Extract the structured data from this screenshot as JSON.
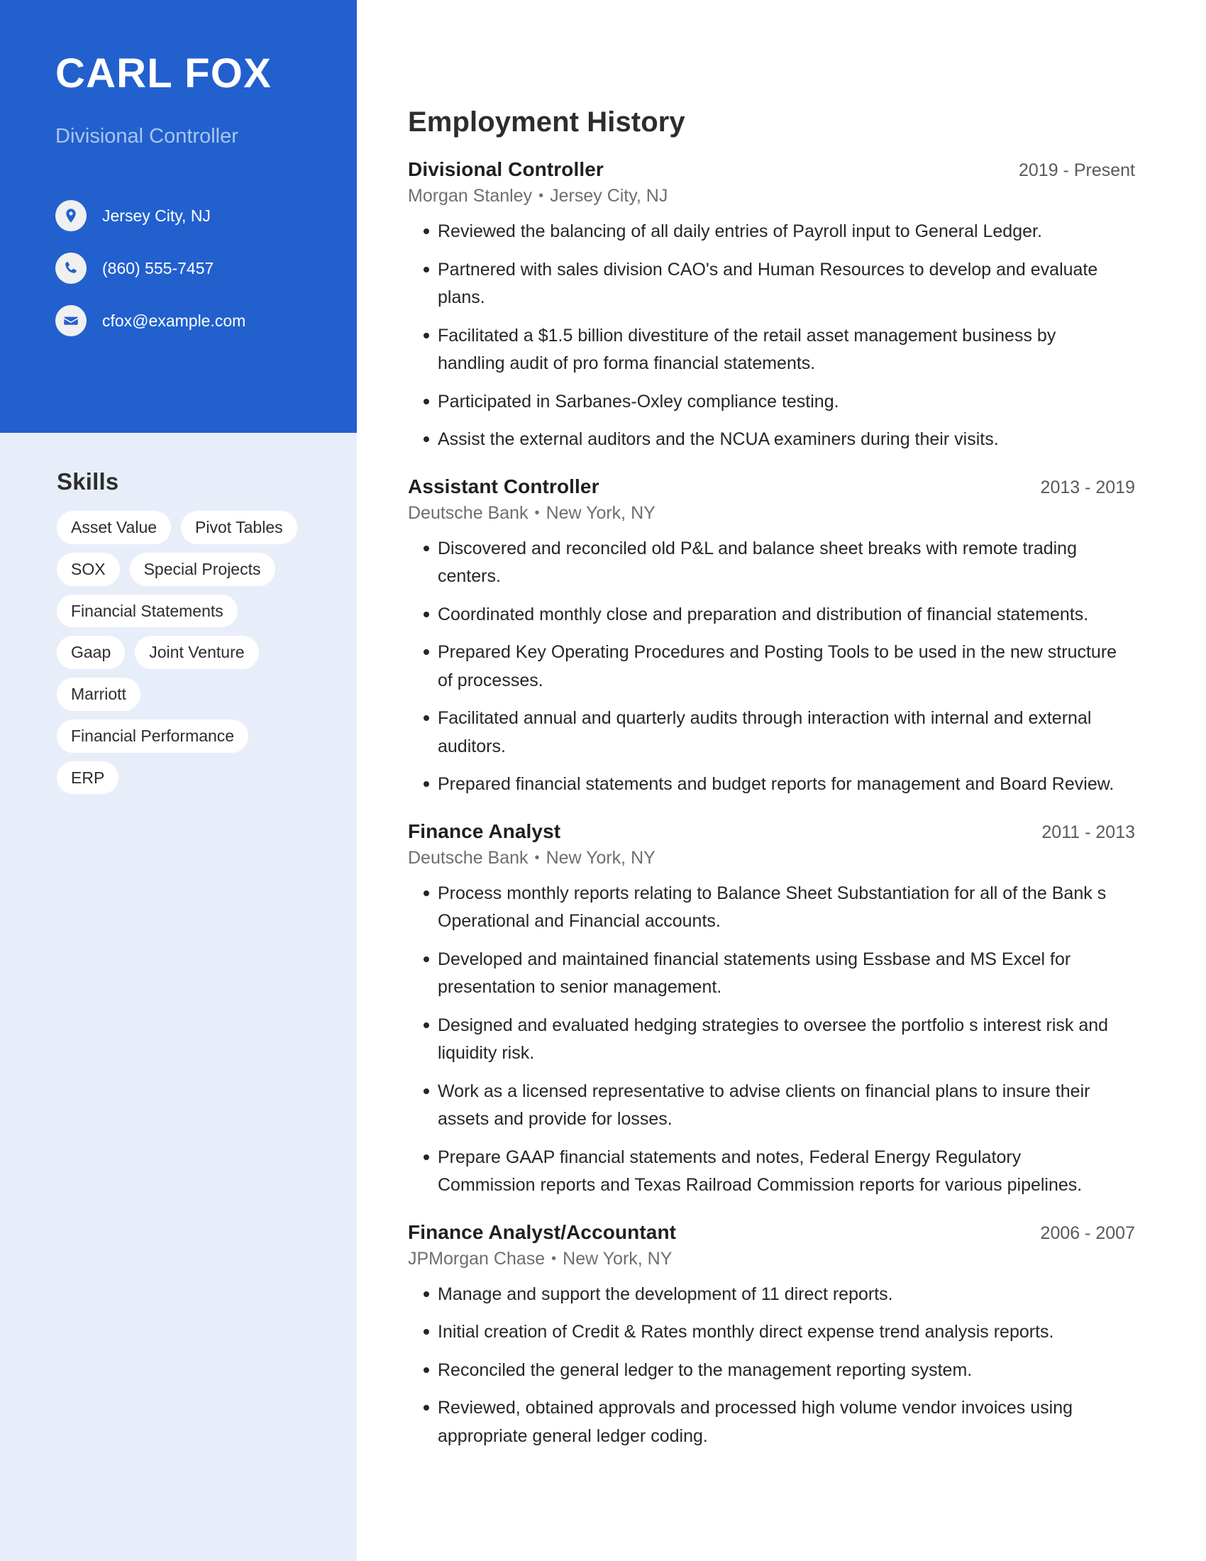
{
  "profile": {
    "name": "CARL FOX",
    "headline": "Divisional Controller"
  },
  "contact": {
    "location": "Jersey City, NJ",
    "phone": "(860) 555-7457",
    "email": "cfox@example.com",
    "location_icon": "map-pin-icon",
    "phone_icon": "phone-icon",
    "email_icon": "envelope-icon"
  },
  "skills": {
    "title": "Skills",
    "items": [
      "Asset Value",
      "Pivot Tables",
      "SOX",
      "Special Projects",
      "Financial Statements",
      "Gaap",
      "Joint Venture",
      "Marriott",
      "Financial Performance",
      "ERP"
    ]
  },
  "employment": {
    "title": "Employment History",
    "jobs": [
      {
        "title": "Divisional Controller",
        "dates": "2019 - Present",
        "company": "Morgan Stanley",
        "location": "Jersey City, NJ",
        "bullets": [
          "Reviewed the balancing of all daily entries of Payroll input to General Ledger.",
          "Partnered with sales division CAO's and Human Resources to develop and evaluate plans.",
          "Facilitated a $1.5 billion divestiture of the retail asset management business by handling audit of pro forma financial statements.",
          "Participated in Sarbanes-Oxley compliance testing.",
          "Assist the external auditors and the NCUA examiners during their visits."
        ]
      },
      {
        "title": "Assistant Controller",
        "dates": "2013 - 2019",
        "company": "Deutsche Bank",
        "location": "New York, NY",
        "bullets": [
          "Discovered and reconciled old P&L and balance sheet breaks with remote trading centers.",
          "Coordinated monthly close and preparation and distribution of financial statements.",
          "Prepared Key Operating Procedures and Posting Tools to be used in the new structure of processes.",
          "Facilitated annual and quarterly audits through interaction with internal and external auditors.",
          "Prepared financial statements and budget reports for management and Board Review."
        ]
      },
      {
        "title": "Finance Analyst",
        "dates": "2011 - 2013",
        "company": "Deutsche Bank",
        "location": "New York, NY",
        "bullets": [
          "Process monthly reports relating to Balance Sheet Substantiation for all of the Bank s Operational and Financial accounts.",
          "Developed and maintained financial statements using Essbase and MS Excel for presentation to senior management.",
          "Designed and evaluated hedging strategies to oversee the portfolio s interest risk and liquidity risk.",
          "Work as a licensed representative to advise clients on financial plans to insure their assets and provide for losses.",
          "Prepare GAAP financial statements and notes, Federal Energy Regulatory Commission reports and Texas Railroad Commission reports for various pipelines."
        ]
      },
      {
        "title": "Finance Analyst/Accountant",
        "dates": "2006 - 2007",
        "company": "JPMorgan Chase",
        "location": "New York, NY",
        "bullets": [
          "Manage and support the development of 11 direct reports.",
          "Initial creation of Credit & Rates monthly direct expense trend analysis reports.",
          "Reconciled the general ledger to the management reporting system.",
          "Reviewed, obtained approvals and processed high volume vendor invoices using appropriate general ledger coding."
        ]
      }
    ]
  },
  "separator": "•",
  "colors": {
    "accent_blue": "#2260CE",
    "sidebar_bg": "#E8EEF9",
    "headline_blue": "#A9C5EE",
    "text_dark": "#2D2D2D",
    "text_muted": "#6E6E6E"
  }
}
